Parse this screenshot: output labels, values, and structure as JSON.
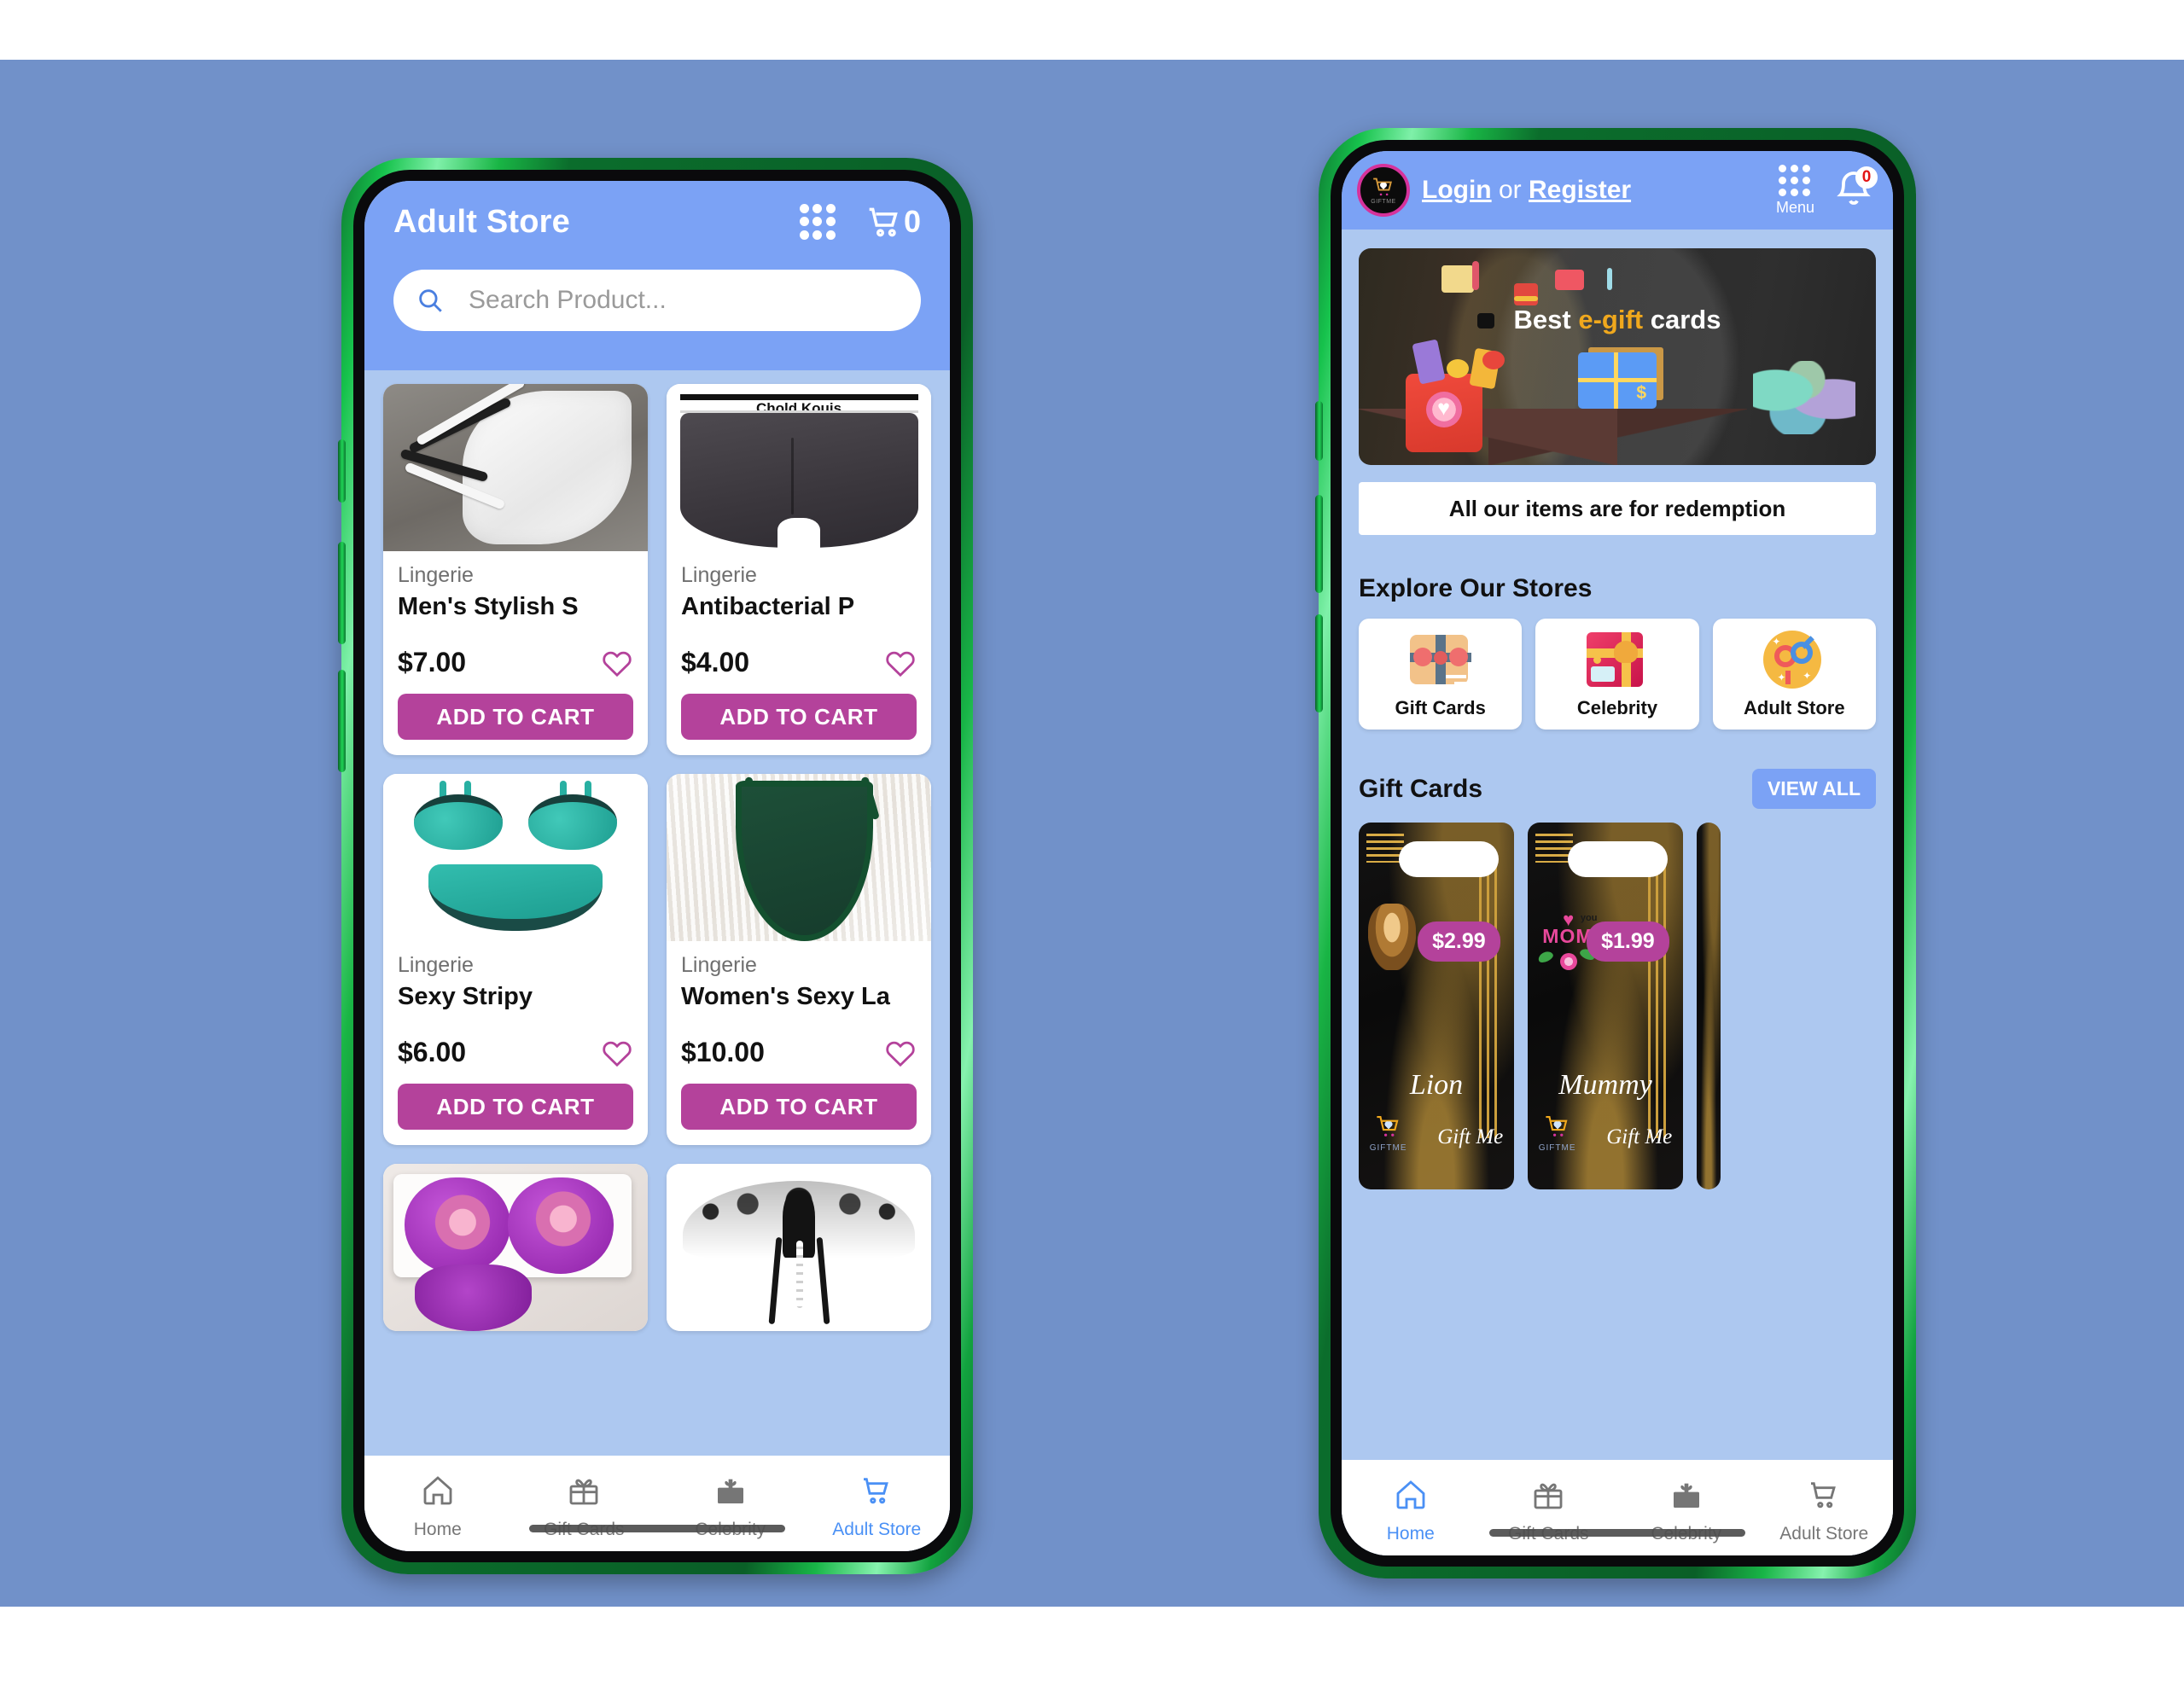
{
  "background": {
    "page_color": "#7191c9",
    "app_color": "#adc8f0",
    "accent_blue": "#7ba2f5",
    "accent_pink": "#b4429b"
  },
  "left_phone": {
    "appbar": {
      "title": "Adult Store",
      "grid_icon": "grid-menu-icon",
      "cart_icon": "shopping-cart-icon",
      "cart_count": "0"
    },
    "search": {
      "placeholder": "Search Product...",
      "icon": "search-icon",
      "value": ""
    },
    "products": [
      {
        "category": "Lingerie",
        "name": "Men's Stylish S",
        "price": "$7.00",
        "favorite_icon": "heart-outline-icon",
        "button": "ADD TO CART",
        "art": "art-thong-white"
      },
      {
        "category": "Lingerie",
        "name": "Antibacterial P",
        "price": "$4.00",
        "favorite_icon": "heart-outline-icon",
        "button": "ADD TO CART",
        "art": "art-boxer",
        "brand_text": "Chold Kouis"
      },
      {
        "category": "Lingerie",
        "name": "Sexy Stripy",
        "price": "$6.00",
        "favorite_icon": "heart-outline-icon",
        "button": "ADD TO CART",
        "art": "art-teal"
      },
      {
        "category": "Lingerie",
        "name": "Women's Sexy La",
        "price": "$10.00",
        "favorite_icon": "heart-outline-icon",
        "button": "ADD TO CART",
        "art": "art-green-thong"
      }
    ],
    "bottom_nav": {
      "items": [
        {
          "label": "Home",
          "icon": "home-icon",
          "active": false
        },
        {
          "label": "Gift Cards",
          "icon": "gift-icon",
          "active": false
        },
        {
          "label": "Celebrity",
          "icon": "gift-icon",
          "active": false
        },
        {
          "label": "Adult Store",
          "icon": "shopping-cart-icon",
          "active": true
        }
      ]
    }
  },
  "right_phone": {
    "appbar": {
      "logo_icon": "giftme-cart-logo-icon",
      "logo_text": "GIFTME",
      "login_label": "Login",
      "or_label": "or",
      "register_label": "Register",
      "menu_icon": "grid-menu-icon",
      "menu_label": "Menu",
      "bell_icon": "bell-notification-icon",
      "bell_count": "0"
    },
    "promo_banner": {
      "title_prefix": "Best ",
      "title_highlight": "e-gift",
      "title_suffix": " cards",
      "highlight_color": "#f0a81d"
    },
    "notice": "All our items are for redemption",
    "explore": {
      "heading": "Explore Our Stores",
      "stores": [
        {
          "label": "Gift Cards",
          "icon": "gift-card-icon"
        },
        {
          "label": "Celebrity",
          "icon": "gift-box-icon"
        },
        {
          "label": "Adult Store",
          "icon": "gender-symbols-icon"
        }
      ]
    },
    "gift_cards_section": {
      "heading": "Gift Cards",
      "view_all_label": "VIEW ALL",
      "cards": [
        {
          "name": "Lion",
          "price": "$2.99",
          "brand": "Gift Me",
          "logo_text": "GIFTME",
          "art": "lion"
        },
        {
          "name": "Mummy",
          "price": "$1.99",
          "brand": "Gift Me",
          "logo_text": "GIFTME",
          "art": "mom",
          "art_text": "MOM",
          "art_subtext": "you"
        }
      ]
    },
    "bottom_nav": {
      "items": [
        {
          "label": "Home",
          "icon": "home-icon",
          "active": true
        },
        {
          "label": "Gift Cards",
          "icon": "gift-icon",
          "active": false
        },
        {
          "label": "Celebrity",
          "icon": "gift-icon",
          "active": false
        },
        {
          "label": "Adult Store",
          "icon": "shopping-cart-icon",
          "active": false
        }
      ]
    }
  }
}
